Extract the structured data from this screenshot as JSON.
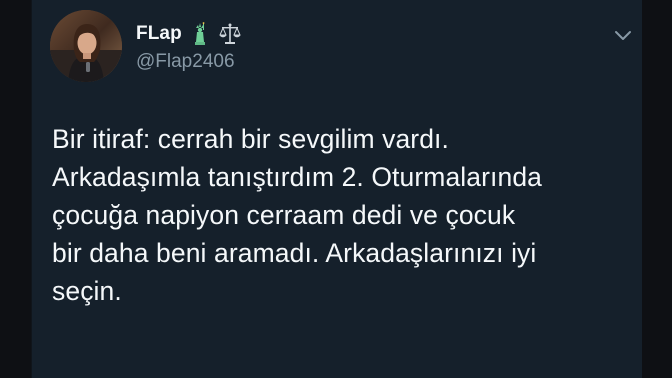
{
  "tweet": {
    "author": {
      "display_name": "FLap",
      "handle": "@Flap2406",
      "avatar": "avatar",
      "badges": [
        "statue-of-liberty-icon",
        "balance-scale-icon"
      ]
    },
    "menu_icon": "chevron-down-icon",
    "text_lines": [
      "Bir itiraf: cerrah bir sevgilim vardı.",
      "Arkadaşımla tanıştırdım 2. Oturmalarında",
      "çocuğa napiyon cerraam dedi ve çocuk",
      "bir daha beni aramadı. Arkadaşlarınızı iyi",
      "seçin."
    ]
  },
  "colors": {
    "background": "#15202b",
    "text_primary": "#f5f8fa",
    "text_secondary": "#8899a6",
    "outer_frame": "#0e1014"
  }
}
